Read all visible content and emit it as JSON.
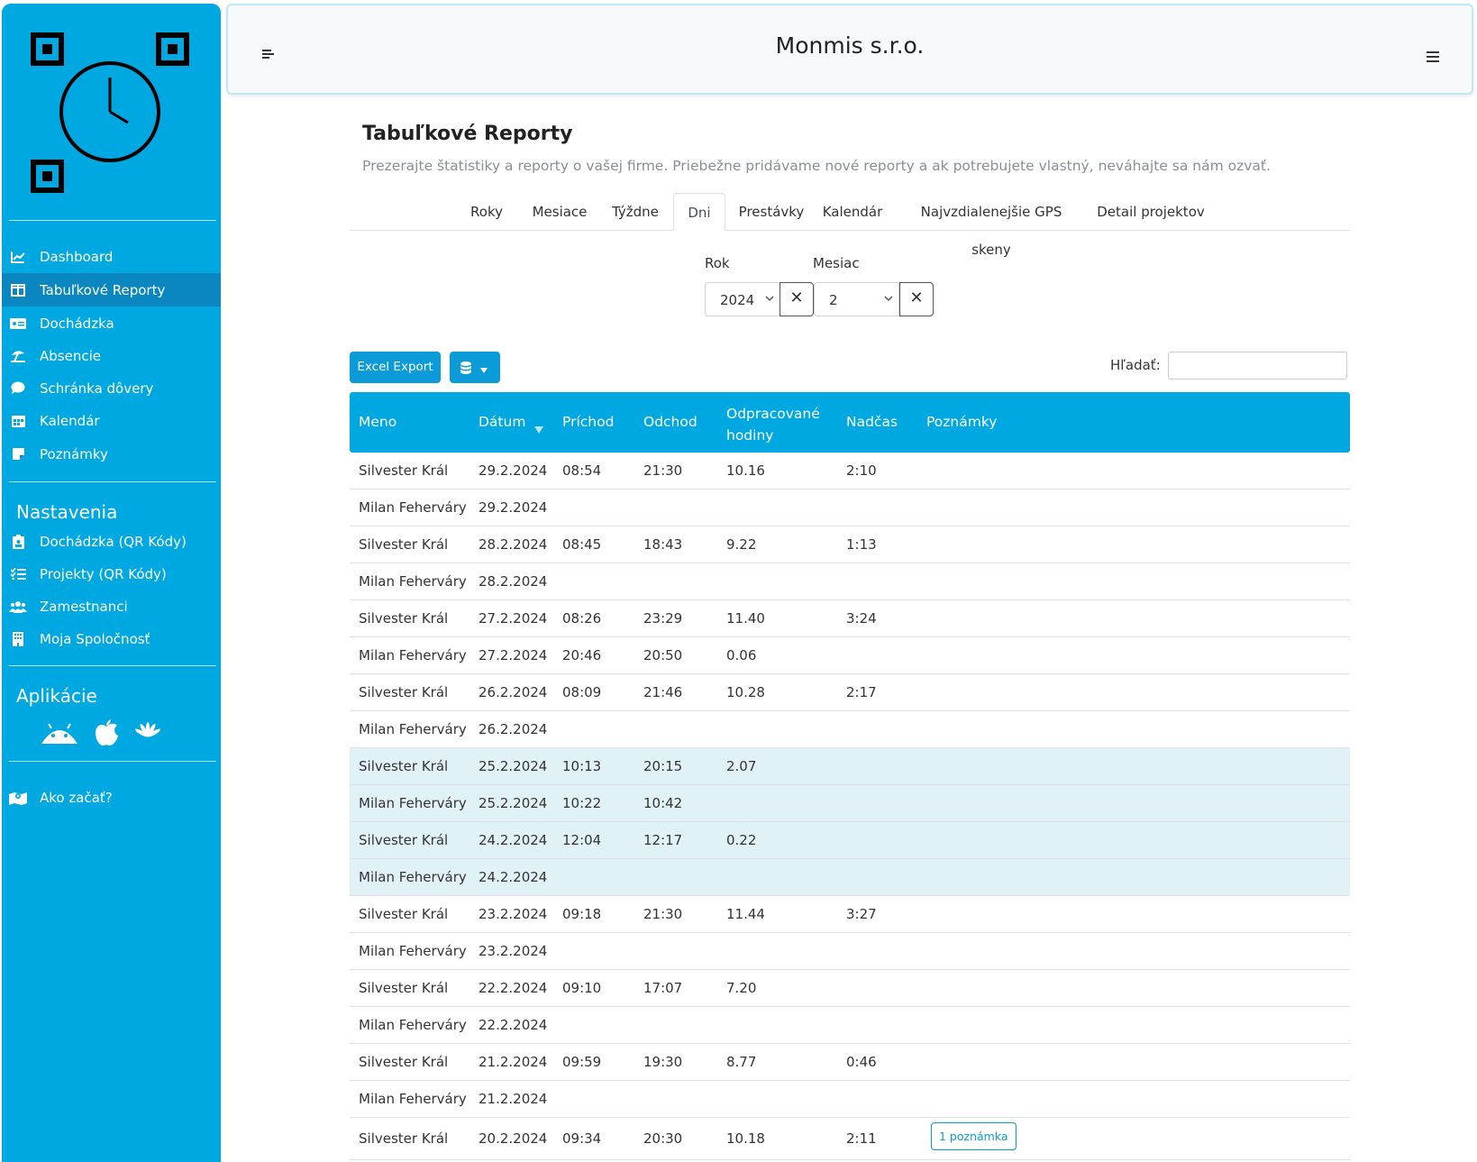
{
  "app": {
    "company": "Monmis s.r.o."
  },
  "sidebar": {
    "items": [
      {
        "label": "Dashboard",
        "icon": "chart-line-icon"
      },
      {
        "label": "Tabuľkové Reporty",
        "icon": "table-icon"
      },
      {
        "label": "Dochádzka",
        "icon": "id-card-icon"
      },
      {
        "label": "Absencie",
        "icon": "umbrella-beach-icon"
      },
      {
        "label": "Schránka dôvery",
        "icon": "comment-icon"
      },
      {
        "label": "Kalendár",
        "icon": "calendar-icon"
      },
      {
        "label": "Poznámky",
        "icon": "sticky-note-icon"
      }
    ],
    "settings_heading": "Nastavenia",
    "settings_items": [
      {
        "label": "Dochádzka (QR Kódy)",
        "icon": "clipboard-user-icon"
      },
      {
        "label": "Projekty (QR Kódy)",
        "icon": "list-check-icon"
      },
      {
        "label": "Zamestnanci",
        "icon": "users-icon"
      },
      {
        "label": "Moja Spoločnosť",
        "icon": "building-icon"
      }
    ],
    "apps_heading": "Aplikácie",
    "apps": [
      "android-icon",
      "apple-icon",
      "huawei-icon"
    ],
    "help_item": {
      "label": "Ako začať?",
      "icon": "map-location-icon"
    }
  },
  "page": {
    "title": "Tabuľkové Reporty",
    "subtitle": "Prezerajte štatistiky a reporty o vašej firme. Priebežne pridávame nové reporty a ak potrebujete vlastný, neváhajte sa nám ozvať.",
    "tabs": [
      "Roky",
      "Mesiace",
      "Týždne",
      "Dni",
      "Prestávky",
      "Kalendár",
      "Najvzdialenejšie GPS skeny",
      "Detail projektov"
    ],
    "active_tab": "Dni"
  },
  "filters": {
    "year_label": "Rok",
    "year_value": "2024",
    "month_label": "Mesiac",
    "month_value": "2",
    "clear_symbol": "✕"
  },
  "toolbar": {
    "excel_label": "Excel Export",
    "search_label": "Hľadať:"
  },
  "table": {
    "columns": [
      "Meno",
      "Dátum",
      "Príchod",
      "Odchod",
      "Odpracované hodiny",
      "Nadčas",
      "Poznámky"
    ],
    "rows": [
      [
        "Silvester Král",
        "29.2.2024",
        "08:54",
        "21:30",
        "10.16",
        "2:10",
        ""
      ],
      [
        "Milan Feherváry",
        "29.2.2024",
        "",
        "",
        "",
        "",
        ""
      ],
      [
        "Silvester Král",
        "28.2.2024",
        "08:45",
        "18:43",
        "9.22",
        "1:13",
        ""
      ],
      [
        "Milan Feherváry",
        "28.2.2024",
        "",
        "",
        "",
        "",
        ""
      ],
      [
        "Silvester Král",
        "27.2.2024",
        "08:26",
        "23:29",
        "11.40",
        "3:24",
        ""
      ],
      [
        "Milan Feherváry",
        "27.2.2024",
        "20:46",
        "20:50",
        "0.06",
        "",
        ""
      ],
      [
        "Silvester Král",
        "26.2.2024",
        "08:09",
        "21:46",
        "10.28",
        "2:17",
        ""
      ],
      [
        "Milan Feherváry",
        "26.2.2024",
        "",
        "",
        "",
        "",
        ""
      ],
      [
        "Silvester Král",
        "25.2.2024",
        "10:13",
        "20:15",
        "2.07",
        "",
        ""
      ],
      [
        "Milan Feherváry",
        "25.2.2024",
        "10:22",
        "10:42",
        "",
        "",
        ""
      ],
      [
        "Silvester Král",
        "24.2.2024",
        "12:04",
        "12:17",
        "0.22",
        "",
        ""
      ],
      [
        "Milan Feherváry",
        "24.2.2024",
        "",
        "",
        "",
        "",
        ""
      ],
      [
        "Silvester Král",
        "23.2.2024",
        "09:18",
        "21:30",
        "11.44",
        "3:27",
        ""
      ],
      [
        "Milan Feherváry",
        "23.2.2024",
        "",
        "",
        "",
        "",
        ""
      ],
      [
        "Silvester Král",
        "22.2.2024",
        "09:10",
        "17:07",
        "7.20",
        "",
        ""
      ],
      [
        "Milan Feherváry",
        "22.2.2024",
        "",
        "",
        "",
        "",
        ""
      ],
      [
        "Silvester Král",
        "21.2.2024",
        "09:59",
        "19:30",
        "8.77",
        "0:46",
        ""
      ],
      [
        "Milan Feherváry",
        "21.2.2024",
        "",
        "",
        "",
        "",
        ""
      ],
      [
        "Silvester Král",
        "20.2.2024",
        "09:34",
        "20:30",
        "10.18",
        "2:11",
        "1 poznámka"
      ]
    ],
    "highlighted_rows": [
      8,
      9,
      10,
      11
    ]
  },
  "colors": {
    "brand": "#00a8e1",
    "active_nav": "#0a87c0",
    "button": "#0a9bd8",
    "highlight_row": "#e1f2f7"
  }
}
